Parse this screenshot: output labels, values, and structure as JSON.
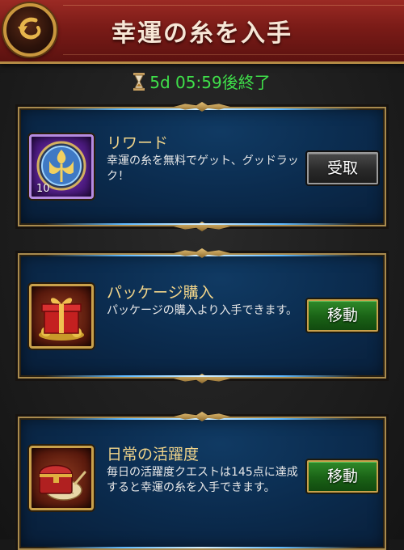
{
  "header": {
    "title": "幸運の糸を入手"
  },
  "timer": {
    "text": "5d 05:59後終了",
    "icon": "hourglass-icon"
  },
  "cards": [
    {
      "title": "リワード",
      "description": "幸運の糸を無料でゲット、グッドラック！",
      "item_count": "10",
      "icon": "luck-thread-token-icon",
      "button": "受取"
    },
    {
      "title": "パッケージ購入",
      "description": "パッケージの購入より入手できます。",
      "icon": "gift-box-icon",
      "button": "移動"
    },
    {
      "title": "日常の活躍度",
      "description": "毎日の活躍度クエストは145点に達成すると幸運の糸を入手できます。",
      "icon": "treasure-chest-icon",
      "button": "移動"
    }
  ],
  "colors": {
    "header_red": "#7a1b17",
    "timer_green": "#3fe04a",
    "card_blue": "#0b2c4f",
    "gold_border": "#c9a14b",
    "title_gold": "#f2d58a"
  }
}
